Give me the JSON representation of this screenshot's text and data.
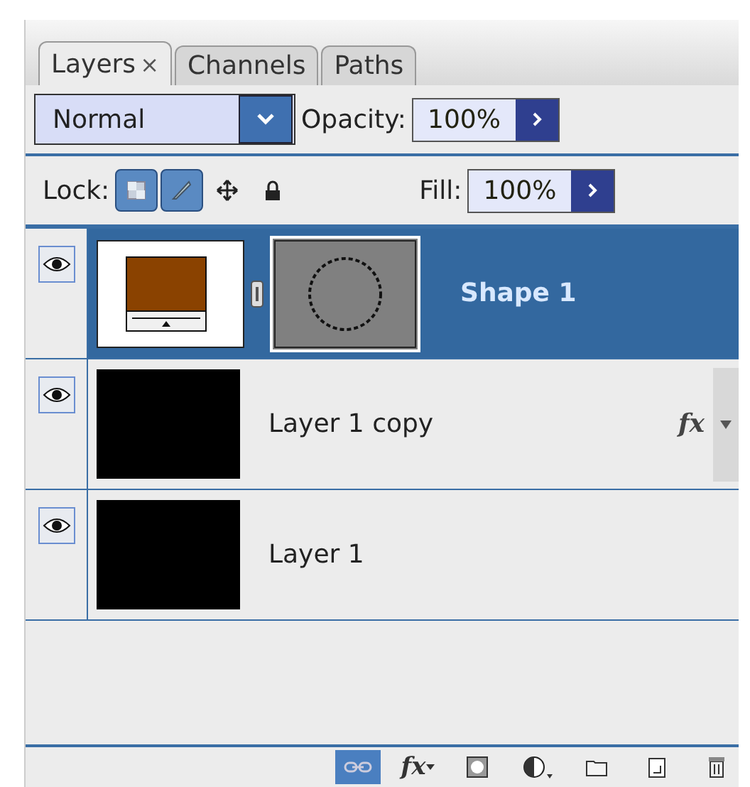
{
  "tabs": [
    {
      "label": "Layers",
      "selected": true,
      "close": "×"
    },
    {
      "label": "Channels",
      "selected": false
    },
    {
      "label": "Paths",
      "selected": false
    }
  ],
  "blend_mode": {
    "value": "Normal"
  },
  "opacity": {
    "label": "Opacity:",
    "value": "100%"
  },
  "lock": {
    "label": "Lock:",
    "buttons": [
      {
        "kind": "transparency",
        "on": true
      },
      {
        "kind": "brush",
        "on": true
      },
      {
        "kind": "move",
        "on": false
      },
      {
        "kind": "all",
        "on": false
      }
    ]
  },
  "fill": {
    "label": "Fill:",
    "value": "100%"
  },
  "layers": [
    {
      "name": "Shape 1",
      "kind": "shape",
      "visible": true,
      "selected": true
    },
    {
      "name": "Layer 1 copy",
      "kind": "pixel",
      "visible": true,
      "selected": false,
      "fx": "fx"
    },
    {
      "name": "Layer 1",
      "kind": "pixel",
      "visible": true,
      "selected": false
    }
  ],
  "footer": [
    {
      "kind": "link",
      "on": true
    },
    {
      "kind": "fx",
      "label": "fx",
      "on": false
    },
    {
      "kind": "mask",
      "on": false
    },
    {
      "kind": "adjust",
      "on": false
    },
    {
      "kind": "folder",
      "on": false
    },
    {
      "kind": "new",
      "on": false
    },
    {
      "kind": "trash",
      "on": false
    }
  ]
}
